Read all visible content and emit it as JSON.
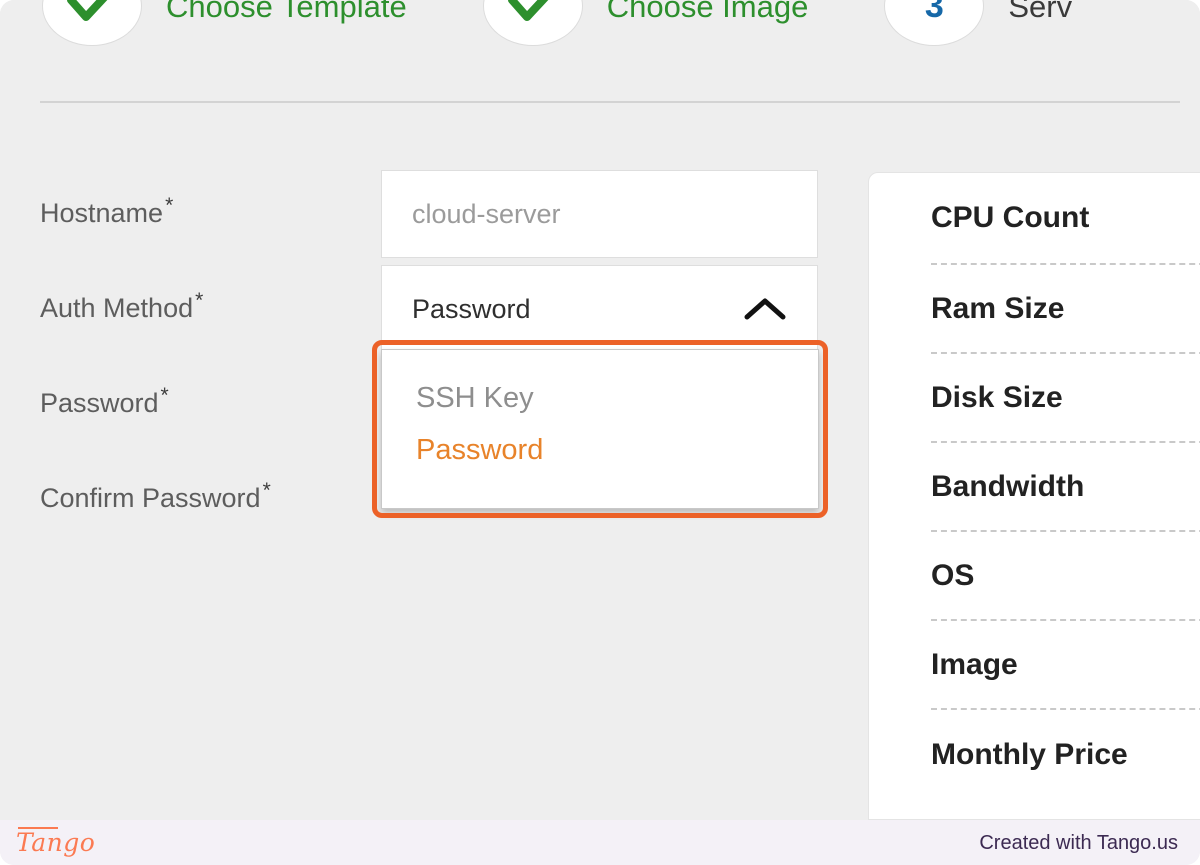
{
  "stepper": {
    "steps": [
      {
        "state": "done",
        "icon": "check-icon",
        "label": "Choose Template"
      },
      {
        "state": "done",
        "icon": "check-icon",
        "label": "Choose Image"
      },
      {
        "state": "current",
        "number": "3",
        "label": "Serv"
      }
    ],
    "done_color": "#2d8f2d",
    "current_number_color": "#1668a8"
  },
  "form": {
    "fields": [
      {
        "label": "Hostname",
        "required": "*",
        "value": "cloud-server",
        "type": "text"
      },
      {
        "label": "Auth Method",
        "required": "*",
        "value": "Password",
        "type": "select",
        "icon": "chevron-up-icon"
      },
      {
        "label": "Password",
        "required": "*",
        "value": "",
        "type": "password"
      },
      {
        "label": "Confirm Password",
        "required": "*",
        "value": "",
        "type": "password"
      }
    ]
  },
  "dropdown": {
    "open": true,
    "highlight_color": "#ec6127",
    "selected_color": "#e8832a",
    "options": [
      {
        "label": "SSH Key",
        "selected": false
      },
      {
        "label": "Password",
        "selected": true
      }
    ]
  },
  "summary": {
    "items": [
      "CPU Count",
      "Ram Size",
      "Disk Size",
      "Bandwidth",
      "OS",
      "Image",
      "Monthly Price"
    ]
  },
  "footer": {
    "logo": "Tango",
    "credit": "Created with Tango.us",
    "logo_color": "#fb7a52",
    "credit_color": "#3c2a52"
  }
}
